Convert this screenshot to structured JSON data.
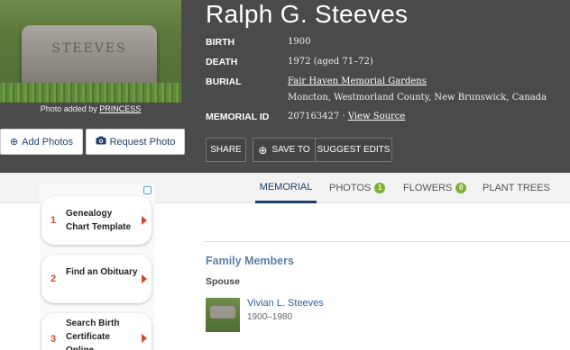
{
  "memorial": {
    "name": "Ralph G. Steeves",
    "photo_inscription": "STEEVES",
    "photo_credit_prefix": "Photo added by",
    "photo_credit_user": "PRINCESS",
    "facts": {
      "birth_label": "BIRTH",
      "birth_value": "1900",
      "death_label": "DEATH",
      "death_value": "1972 (aged 71–72)",
      "burial_label": "BURIAL",
      "burial_cemetery": "Fair Haven Memorial Gardens",
      "burial_location": "Moncton, Westmorland County, New Brunswick, Canada",
      "memorial_id_label": "MEMORIAL ID",
      "memorial_id_value": "207163427 ·",
      "view_source": "View Source"
    }
  },
  "buttons": {
    "add_photos": "Add Photos",
    "request_photo": "Request Photo",
    "share": "SHARE",
    "save_to": "SAVE TO",
    "suggest_edits": "SUGGEST EDITS"
  },
  "tabs": {
    "memorial": "MEMORIAL",
    "photos": "PHOTOS",
    "photos_count": "1",
    "flowers": "FLOWERS",
    "flowers_count": "0",
    "plant_trees": "PLANT TREES"
  },
  "ad": {
    "items": [
      {
        "num": "1",
        "text": "Genealogy Chart Template"
      },
      {
        "num": "2",
        "text": "Find an Obituary"
      },
      {
        "num": "3",
        "text": "Search Birth Certificate Online"
      }
    ]
  },
  "family": {
    "title": "Family Members",
    "spouse_label": "Spouse",
    "spouse_name": "Vivian L. Steeves",
    "spouse_dates": "1900–1980"
  },
  "colors": {
    "hero_bg": "#4a4a4a",
    "link": "#2e5f9e",
    "accent_green": "#7bb234",
    "ad_accent": "#d14a2b"
  },
  "icons": {
    "add_photos": "plus-circle-icon",
    "request_photo": "camera-icon",
    "save_to": "plus-circle-icon",
    "ad_choices": "adchoices-icon"
  }
}
